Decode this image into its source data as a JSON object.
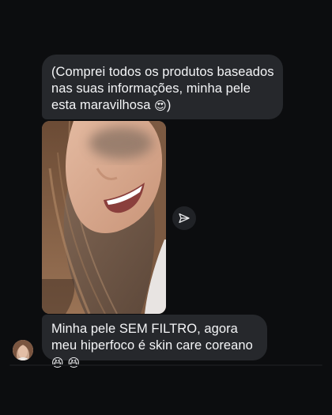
{
  "thread": {
    "messages": [
      {
        "text": "(Comprei todos os produtos baseados nas suas informações, minha pele esta maravilhosa",
        "emoji": "😍",
        "suffix": ")"
      },
      {
        "text": "Minha pele SEM FILTRO, agora meu hiperfoco é skin care coreano",
        "emoji": "😆 😆"
      }
    ],
    "photo_icon": "smiling-woman-photo",
    "share_icon": "paper-plane-icon",
    "avatar_icon": "sender-avatar"
  },
  "colors": {
    "background": "#0c0d0f",
    "bubble": "#26282c",
    "text": "#f4f5f7"
  }
}
